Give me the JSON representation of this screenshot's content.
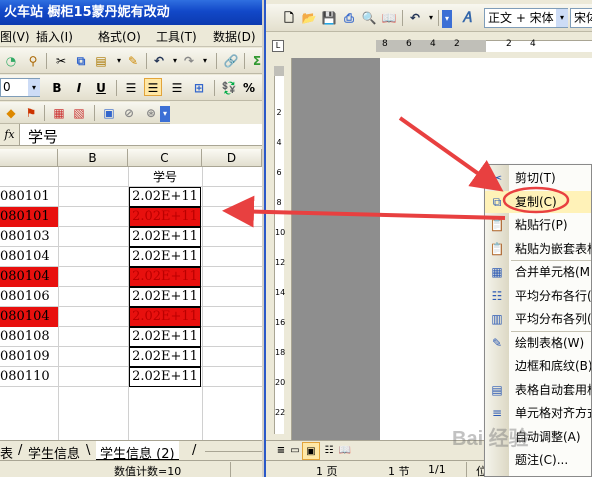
{
  "excel": {
    "title": "火车站  橱柜15蒙丹妮有改动",
    "menu": [
      "图(V)",
      "插入(I)",
      "格式(O)",
      "工具(T)",
      "数据(D)"
    ],
    "font_size": "0",
    "formula_fx": "fx",
    "formula_value": "学号",
    "columns": [
      "B",
      "C",
      "D"
    ],
    "rows": [
      {
        "a": "",
        "c": "学号",
        "a_red": false,
        "c_red": false,
        "c_header": true
      },
      {
        "a": "080101",
        "c": "2.02E+11",
        "a_red": false,
        "c_red": false
      },
      {
        "a": "080101",
        "c": "2.02E+11",
        "a_red": true,
        "c_red": true
      },
      {
        "a": "080103",
        "c": "2.02E+11",
        "a_red": false,
        "c_red": false
      },
      {
        "a": "080104",
        "c": "2.02E+11",
        "a_red": false,
        "c_red": false
      },
      {
        "a": "080104",
        "c": "2.02E+11",
        "a_red": true,
        "c_red": true
      },
      {
        "a": "080106",
        "c": "2.02E+11",
        "a_red": false,
        "c_red": false
      },
      {
        "a": "080104",
        "c": "2.02E+11",
        "a_red": true,
        "c_red": true
      },
      {
        "a": "080108",
        "c": "2.02E+11",
        "a_red": false,
        "c_red": false
      },
      {
        "a": "080109",
        "c": "2.02E+11",
        "a_red": false,
        "c_red": false
      },
      {
        "a": "080110",
        "c": "2.02E+11",
        "a_red": false,
        "c_red": false
      }
    ],
    "sheet_tabs": [
      "表",
      "学生信息",
      "学生信息 (2)"
    ],
    "status": "数值计数=10"
  },
  "word": {
    "style_box": "正文 + 宋体",
    "font_box": "宋体",
    "ruler_numbers": [
      "8",
      "6",
      "4",
      "2",
      "2",
      "4"
    ],
    "status": {
      "page": "1 页",
      "section": "1 节",
      "pages": "1/1",
      "pos": "位"
    },
    "context_menu": [
      {
        "label": "剪切(T)",
        "icon": "scissors-icon",
        "glyph": "✂"
      },
      {
        "label": "复制(C)",
        "icon": "copy-icon",
        "glyph": "⧉",
        "highlight": true
      },
      {
        "label": "粘贴行(P)",
        "icon": "paste-icon",
        "glyph": "📋"
      },
      {
        "label": "粘贴为嵌套表格",
        "icon": "paste-nested-icon",
        "glyph": "📋"
      },
      {
        "label": "合并单元格(M)",
        "icon": "merge-cells-icon",
        "glyph": "▦"
      },
      {
        "label": "平均分布各行(N)",
        "icon": "distribute-rows-icon",
        "glyph": "☷"
      },
      {
        "label": "平均分布各列(Y)",
        "icon": "distribute-cols-icon",
        "glyph": "▥"
      },
      {
        "label": "绘制表格(W)",
        "icon": "draw-table-icon",
        "glyph": "✎"
      },
      {
        "label": "边框和底纹(B)...",
        "icon": "",
        "glyph": ""
      },
      {
        "label": "表格自动套用格式",
        "icon": "autoformat-icon",
        "glyph": "▤"
      },
      {
        "label": "单元格对齐方式",
        "icon": "align-icon",
        "glyph": "≡"
      },
      {
        "label": "自动调整(A)",
        "icon": "",
        "glyph": ""
      },
      {
        "label": "题注(C)...",
        "icon": "",
        "glyph": ""
      }
    ]
  },
  "watermark": "Bai 经验",
  "colors": {
    "red": "#e8100e",
    "arrow": "#e84040",
    "title_blue": "#1c55d3",
    "highlight": "#fff2b8"
  }
}
